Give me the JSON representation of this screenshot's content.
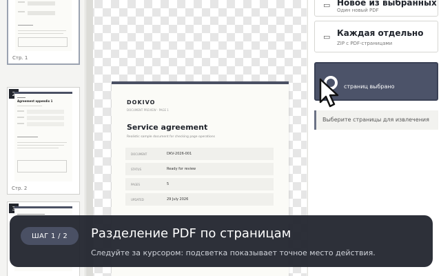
{
  "thumbnails": [
    {
      "number": "",
      "label": "Стр. 1"
    },
    {
      "number": "2",
      "label": "Стр. 2",
      "heading": "Agreement appendix 1"
    },
    {
      "number": "3",
      "label": ""
    }
  ],
  "document": {
    "brand": "DOKIVO",
    "breadcrumb": "DOCUMENT PREVIEW · PAGE 1",
    "title": "Service agreement",
    "subtitle": "Realistic sample document for checking page operations",
    "fields": [
      {
        "key": "DOCUMENT",
        "value": "DKV-2026-001"
      },
      {
        "key": "STATUS",
        "value": "Ready for review"
      },
      {
        "key": "PAGES",
        "value": "5"
      },
      {
        "key": "UPDATED",
        "value": "29 July 2026"
      }
    ]
  },
  "panel": {
    "option_selected": {
      "title": "Новое из выбранных",
      "subtitle": "Один новый PDF"
    },
    "option_each": {
      "title": "Каждая отдельно",
      "subtitle": "ZIP с PDF-страницами"
    },
    "extract_button": "страниц выбрано",
    "hint": "Выберите страницы для извлечения"
  },
  "overlay": {
    "step": "ШАГ 1 / 2",
    "title": "Разделение PDF по страницам",
    "subtitle": "Следуйте за курсором: подсветка показывает точное место действия."
  },
  "colors": {
    "accent": "#4c5369",
    "overlay_bg": "#20232d",
    "page_top": "#4a5063"
  }
}
